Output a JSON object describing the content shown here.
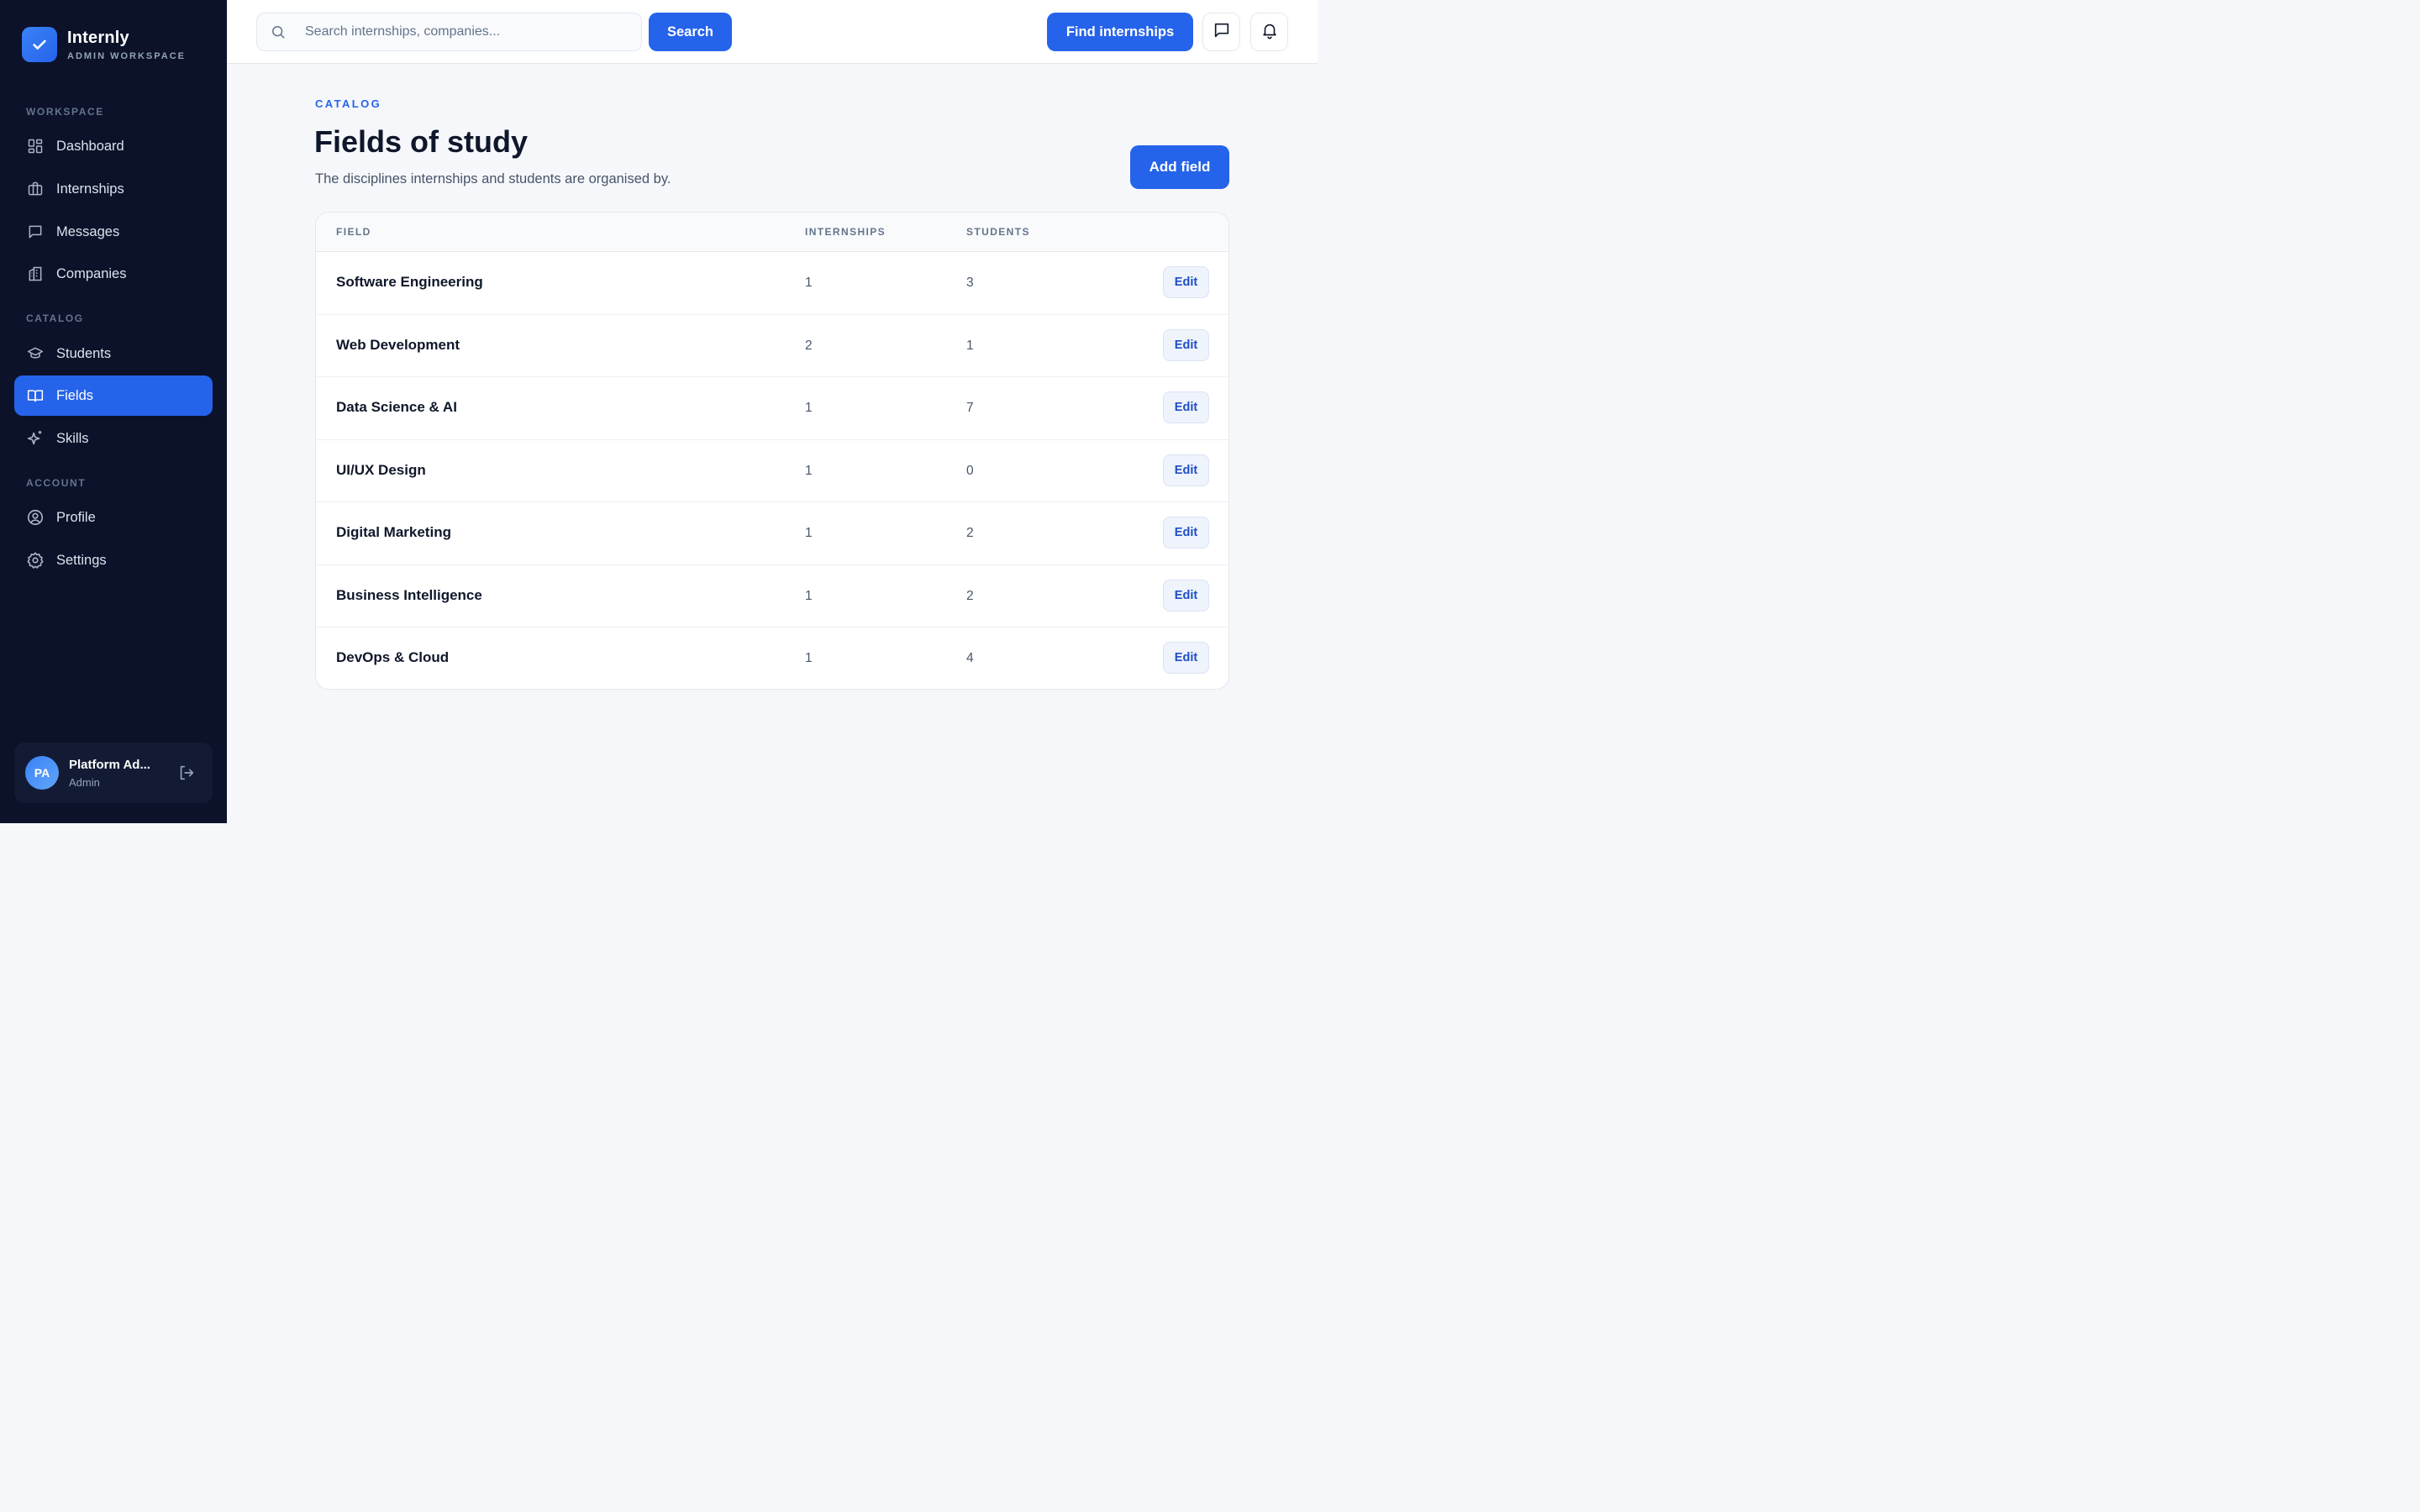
{
  "brand": {
    "name": "Internly",
    "subtitle": "ADMIN WORKSPACE"
  },
  "sidebar": {
    "sections": [
      {
        "label": "WORKSPACE"
      },
      {
        "label": "CATALOG"
      },
      {
        "label": "ACCOUNT"
      }
    ],
    "items": [
      {
        "label": "Dashboard",
        "icon": "dashboard-icon"
      },
      {
        "label": "Internships",
        "icon": "briefcase-icon"
      },
      {
        "label": "Messages",
        "icon": "message-icon"
      },
      {
        "label": "Companies",
        "icon": "building-icon"
      },
      {
        "label": "Students",
        "icon": "graduation-cap-icon"
      },
      {
        "label": "Fields",
        "icon": "book-icon",
        "active": true
      },
      {
        "label": "Skills",
        "icon": "sparkles-icon"
      },
      {
        "label": "Profile",
        "icon": "user-circle-icon"
      },
      {
        "label": "Settings",
        "icon": "gear-icon"
      }
    ]
  },
  "user": {
    "initials": "PA",
    "name": "Platform Ad...",
    "role": "Admin"
  },
  "header": {
    "search_placeholder": "Search internships, companies...",
    "search_label": "Search",
    "find_label": "Find internships"
  },
  "page": {
    "eyebrow": "CATALOG",
    "title": "Fields of study",
    "subtitle": "The disciplines internships and students are organised by.",
    "add_label": "Add field"
  },
  "table": {
    "headers": {
      "field": "FIELD",
      "internships": "INTERNSHIPS",
      "students": "STUDENTS"
    },
    "edit_label": "Edit",
    "rows": [
      {
        "field": "Software Engineering",
        "internships": "1",
        "students": "3"
      },
      {
        "field": "Web Development",
        "internships": "2",
        "students": "1"
      },
      {
        "field": "Data Science & AI",
        "internships": "1",
        "students": "7"
      },
      {
        "field": "UI/UX Design",
        "internships": "1",
        "students": "0"
      },
      {
        "field": "Digital Marketing",
        "internships": "1",
        "students": "2"
      },
      {
        "field": "Business Intelligence",
        "internships": "1",
        "students": "2"
      },
      {
        "field": "DevOps & Cloud",
        "internships": "1",
        "students": "4"
      }
    ]
  },
  "colors": {
    "accent": "#2563eb",
    "sidebar_bg": "#0b1229",
    "page_bg": "#f6f7fb"
  }
}
